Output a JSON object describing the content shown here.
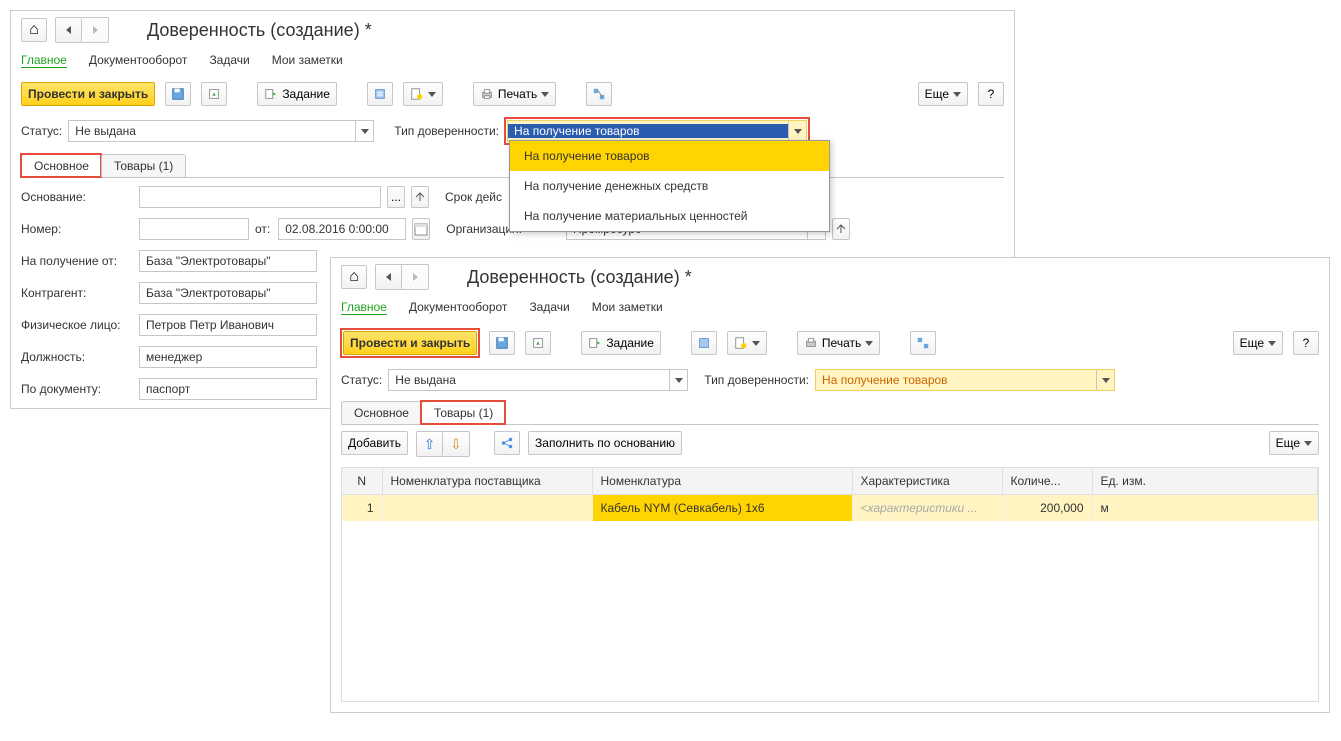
{
  "win1": {
    "title": "Доверенность (создание) *",
    "menu": {
      "main": "Главное",
      "doc": "Документооборот",
      "tasks": "Задачи",
      "notes": "Мои заметки"
    },
    "toolbar": {
      "post_close": "Провести и закрыть",
      "task": "Задание",
      "print": "Печать",
      "more": "Еще",
      "help": "?"
    },
    "filter": {
      "status_label": "Статус:",
      "status_value": "Не выдана",
      "type_label": "Тип доверенности:",
      "type_value": "На получение товаров",
      "dropdown": [
        "На получение товаров",
        "На получение денежных средств",
        "На получение материальных ценностей"
      ]
    },
    "tabs": {
      "main": "Основное",
      "goods": "Товары (1)"
    },
    "form": {
      "basis_label": "Основание:",
      "period_label": "Срок дейс",
      "number_label": "Номер:",
      "from_label": "от:",
      "date_value": "02.08.2016  0:00:00",
      "org_label": "Организация:",
      "org_value": "Промресурс",
      "recv_label": "На получение от:",
      "recv_value": "База \"Электротовары\"",
      "contr_label": "Контрагент:",
      "contr_value": "База \"Электротовары\"",
      "person_label": "Физическое лицо:",
      "person_value": "Петров Петр Иванович",
      "pos_label": "Должность:",
      "pos_value": "менеджер",
      "doc_label": "По документу:",
      "doc_value": "паспорт"
    }
  },
  "win2": {
    "title": "Доверенность (создание) *",
    "menu": {
      "main": "Главное",
      "doc": "Документооборот",
      "tasks": "Задачи",
      "notes": "Мои заметки"
    },
    "toolbar": {
      "post_close": "Провести и закрыть",
      "task": "Задание",
      "print": "Печать",
      "more": "Еще",
      "help": "?"
    },
    "filter": {
      "status_label": "Статус:",
      "status_value": "Не выдана",
      "type_label": "Тип доверенности:",
      "type_value": "На получение товаров"
    },
    "tabs": {
      "main": "Основное",
      "goods": "Товары (1)"
    },
    "table_toolbar": {
      "add": "Добавить",
      "fill": "Заполнить по основанию",
      "more": "Еще"
    },
    "table": {
      "headers": {
        "n": "N",
        "supplier": "Номенклатура поставщика",
        "nomen": "Номенклатура",
        "char": "Характеристика",
        "qty": "Количе...",
        "unit": "Ед. изм."
      },
      "rows": [
        {
          "n": "1",
          "supplier": "",
          "nomen": "Кабель NYM (Севкабель) 1х6",
          "char": "<характеристики ...",
          "qty": "200,000",
          "unit": "м"
        }
      ]
    }
  }
}
